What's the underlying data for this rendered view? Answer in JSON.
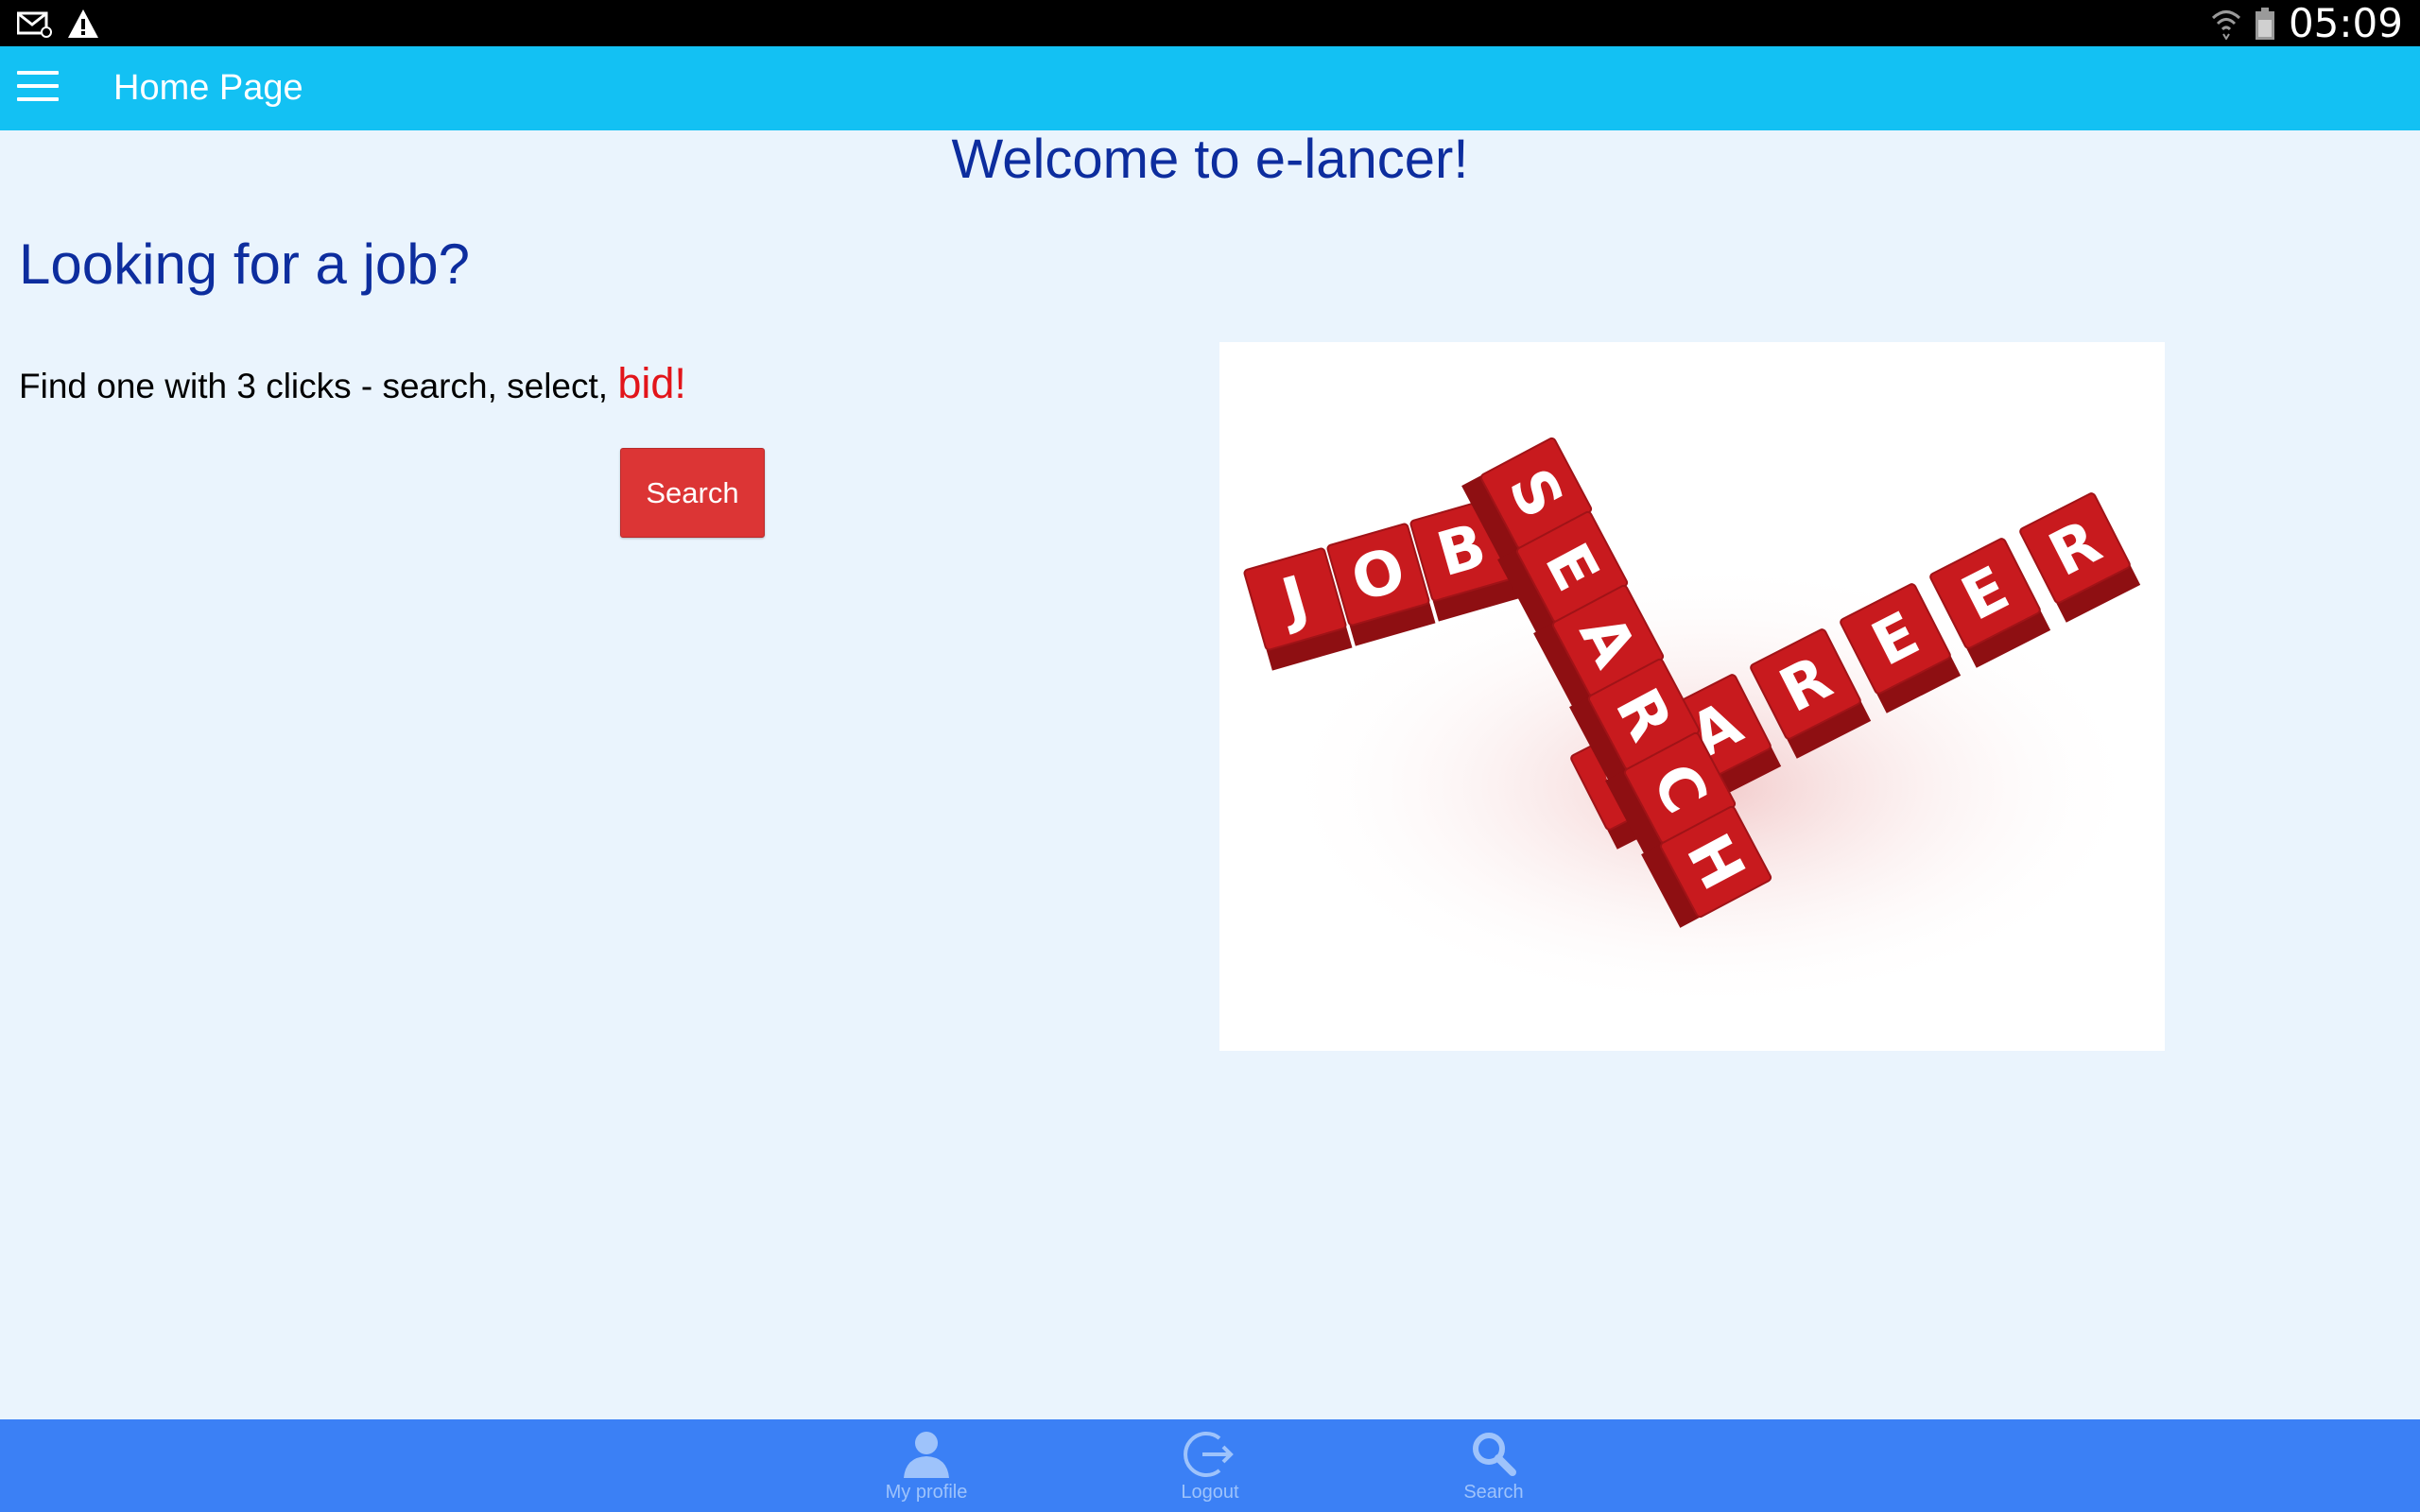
{
  "status_bar": {
    "time": "05:09",
    "icons": [
      "mail-notification-icon",
      "warning-icon",
      "wifi-icon",
      "battery-icon"
    ]
  },
  "app_bar": {
    "title": "Home Page",
    "menu_icon": "hamburger-menu-icon",
    "background_color": "#13c1f3"
  },
  "main": {
    "welcome": "Welcome to e-lancer!",
    "heading": "Looking for a job?",
    "tagline": "Find one with 3 clicks - search, select,",
    "tagline_highlight": "bid!",
    "search_button": "Search",
    "hero_image": {
      "cube_words": [
        "JOBS",
        "SEARCH",
        "CAREER"
      ],
      "cube_color": "#c81a1e"
    }
  },
  "bottom_nav": {
    "background_color": "#3b80f5",
    "items": [
      {
        "label": "My profile",
        "icon": "person-icon"
      },
      {
        "label": "Logout",
        "icon": "logout-icon"
      },
      {
        "label": "Search",
        "icon": "search-icon"
      }
    ]
  },
  "colors": {
    "heading_blue": "#0d2d9e",
    "accent_red": "#e2141a",
    "button_red": "#dc3535",
    "page_background": "#eaf4fd"
  }
}
